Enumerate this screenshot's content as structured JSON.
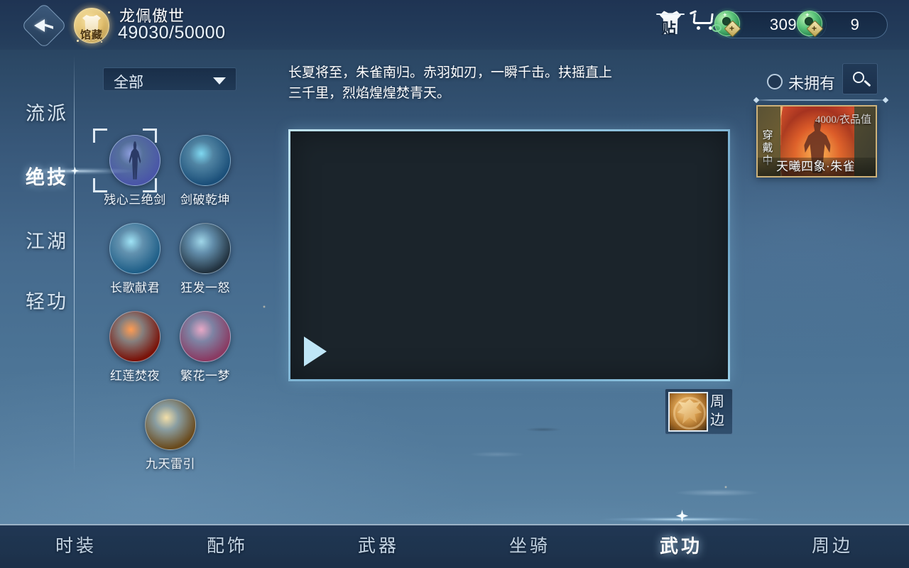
{
  "header": {
    "back_icon": "back-arrow-icon",
    "collection_badge": {
      "label": "馆藏",
      "icon": "robe-icon"
    },
    "hero_name": "龙佩傲世",
    "hero_progress": "49030/50000",
    "wardrobe_icon": "wardrobe-icon",
    "wardrobe_glyph": "贴",
    "cart_icon": "shopping-cart-icon",
    "currencies": [
      {
        "icon": "bound-jade-coin-icon",
        "value": "309"
      },
      {
        "icon": "jade-coin-icon",
        "value": "9"
      }
    ]
  },
  "sidebar": {
    "items": [
      {
        "label": "流派",
        "active": false
      },
      {
        "label": "绝技",
        "active": true
      },
      {
        "label": "江湖",
        "active": false
      },
      {
        "label": "轻功",
        "active": false
      }
    ]
  },
  "filter": {
    "selected": "全部",
    "caret_icon": "chevron-down-icon"
  },
  "skills": [
    {
      "name": "残心三绝剑",
      "selected": true,
      "color_a": "#8f9fe0",
      "color_b": "#4a56a8",
      "figure": true
    },
    {
      "name": "剑破乾坤",
      "selected": false,
      "color_a": "#7fd8f0",
      "color_b": "#1b4f79",
      "figure": false
    },
    {
      "name": "长歌献君",
      "selected": false,
      "color_a": "#9fe3f5",
      "color_b": "#1f5f88",
      "figure": false
    },
    {
      "name": "狂发一怒",
      "selected": false,
      "color_a": "#9fd6e8",
      "color_b": "#22323f",
      "figure": false
    },
    {
      "name": "红莲焚夜",
      "selected": false,
      "color_a": "#ff9b52",
      "color_b": "#7a1208",
      "figure": false
    },
    {
      "name": "繁花一梦",
      "selected": false,
      "color_a": "#e8a8c6",
      "color_b": "#8a3a62",
      "figure": false
    },
    {
      "name": "九天雷引",
      "selected": false,
      "color_a": "#f3dfa8",
      "color_b": "#6a4a1c",
      "figure": false
    }
  ],
  "description": "长夏将至，朱雀南归。赤羽如刃，一瞬千击。扶摇直上三千里，烈焰煌煌焚青天。",
  "video": {
    "play_icon": "play-triangle-icon"
  },
  "peripheral_button": {
    "label": "周边",
    "icon": "phoenix-emblem-icon"
  },
  "right_panel": {
    "owned_filter_label": "未拥有",
    "owned_filter_checked": false,
    "search_icon": "magnifier-icon",
    "item_card": {
      "price": "4000",
      "price_unit": "/衣品值",
      "equipped_label": "穿戴中",
      "title": "天曦四象·朱雀"
    }
  },
  "bottom_nav": {
    "items": [
      {
        "label": "时装",
        "active": false
      },
      {
        "label": "配饰",
        "active": false
      },
      {
        "label": "武器",
        "active": false
      },
      {
        "label": "坐骑",
        "active": false
      },
      {
        "label": "武功",
        "active": true
      },
      {
        "label": "周边",
        "active": false
      }
    ]
  },
  "colors": {
    "accent": "#cde4f6",
    "gold": "#cdb27a",
    "bg_top": "#243e5c",
    "bg_bottom": "#5f88a8"
  }
}
